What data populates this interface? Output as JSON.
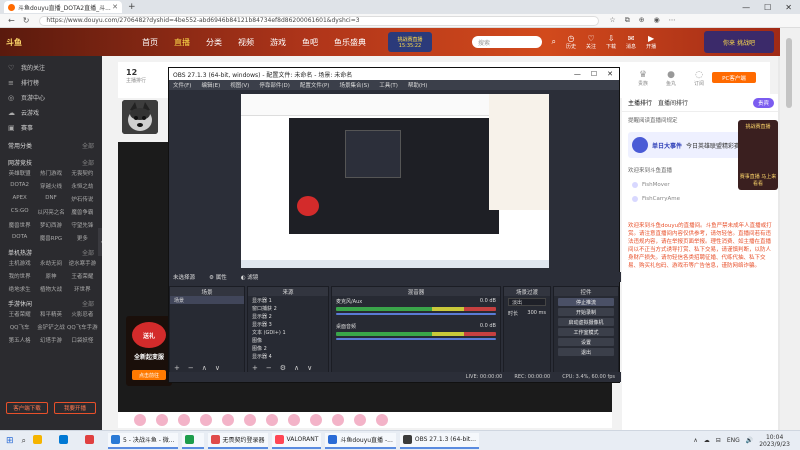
{
  "browser": {
    "tab_title": "斗鱼douyu直播_DOTA2直播_斗...",
    "url": "https://www.douyu.com/2706482?dyshid=4be552-abd6946b84121b84734ef8d86200061601&dyshci=3",
    "newtab": "+",
    "win_min": "—",
    "win_max": "☐",
    "win_close": "✕"
  },
  "site": {
    "nav": [
      "首页",
      "直播",
      "分类",
      "视频",
      "游戏",
      "鱼吧",
      "鱼乐盛典"
    ],
    "promo_top": "挑战赛直播",
    "promo_time": "15:35:22",
    "search_placeholder": "搜索",
    "header_icons": [
      "历史",
      "关注",
      "下载",
      "消息",
      "开播"
    ],
    "header_promo": "你来 挑战吧"
  },
  "sidebar": {
    "items": [
      {
        "icon": "♡",
        "label": "我的关注"
      },
      {
        "icon": "≡",
        "label": "排行榜"
      },
      {
        "icon": "◎",
        "label": "页游中心"
      },
      {
        "icon": "☁",
        "label": "云游戏"
      },
      {
        "icon": "▣",
        "label": "赛事"
      }
    ],
    "section_common": "常用分类",
    "section_online": "网游竞技",
    "section_more": "全部",
    "online_games": [
      "英雄联盟",
      "热门游戏",
      "无畏契约",
      "DOTA2",
      "穿越火线",
      "永恒之劫",
      "APEX",
      "DNF",
      "炉石传说",
      "CS:GO",
      "以闪亮之名",
      "魔兽争霸",
      "魔兽世界",
      "梦幻西游",
      "守望先锋",
      "DOTA",
      "魔兽RPG",
      "更多"
    ],
    "section_single": "单机热游",
    "single_games": [
      "主机游戏",
      "永劫无间",
      "逆水寒手游",
      "我的世界",
      "原神",
      "王者荣耀",
      "绝地求生",
      "植物大战",
      "环世界"
    ],
    "section_mobile": "手游休闲",
    "mobile_games": [
      "王者荣耀",
      "和平精英",
      "火影忍者",
      "QQ飞车",
      "金铲铲之战",
      "QQ飞车手游",
      "第五人格",
      "幻塔手游",
      "口袋妖怪"
    ],
    "btn_download": "客户端下载",
    "btn_live": "我要开播"
  },
  "room": {
    "rank_num": "12",
    "rank_label": "主播排行",
    "pc_client": "PC客户端",
    "icons": [
      "贵族",
      "鱼丸",
      "订阅"
    ]
  },
  "ad": {
    "badge": "送礼",
    "headline": "全新起变服",
    "cta": "点击前往"
  },
  "chat": {
    "tab_rank": "主播排行",
    "tab_gift": "直播间排行",
    "pill": "贵宾",
    "notice": "提醒阅读直播间规定",
    "event_title": "单日大事件",
    "event_text": "今日英雄联盟精彩赛事直播中",
    "note": "欢迎来到斗鱼直播",
    "users": [
      "FishMover",
      "FishCarryAme"
    ],
    "welcome": "欢迎来到斗鱼douyu的直播间。斗鱼严禁未成年人直播或打赏。请注意直播间内容仅供参考，请勿轻信。直播间若有违法违规内容，请在举报页面举报。理性消费、如主播在直播间以不正当方式诱导打赏、私下交易，请谨慎判断，以防人身财产损失。请勿轻信各类招聘征婚、代练代抽、私下交易、购买礼包码、游戏币等广告信息，谨防网络诈骗。",
    "side_ad_top": "挑战赛直播",
    "side_ad_bottom": "赛事直播 马上来看看"
  },
  "obs": {
    "title": "OBS 27.1.3 (64-bit, windows) - 配置文件: 未命名 - 场景: 未命名",
    "menu": [
      "文件(F)",
      "编辑(E)",
      "视图(V)",
      "停靠部件(D)",
      "配置文件(P)",
      "场景集合(S)",
      "工具(T)",
      "帮助(H)"
    ],
    "no_source": "未选择源",
    "props": "属性",
    "filters": "滤镜",
    "scenes_title": "场景",
    "scene_item": "场景",
    "sources_title": "来源",
    "sources": [
      "显示器 1",
      "窗口捕获 2",
      "显示器 2",
      "显示器 3",
      "文本 (GDI+) 1",
      "图像",
      "图像 2",
      "显示器 4",
      "显示器 5"
    ],
    "mixer_title": "混音器",
    "mixer_track1": "麦克风/Aux",
    "mixer_track1_db": "0.0 dB",
    "mixer_track2": "桌面音频",
    "mixer_track2_db": "0.0 dB",
    "transitions_title": "场景过渡",
    "transition_type": "淡出",
    "duration_label": "时长",
    "duration": "300 ms",
    "controls_title": "控件",
    "controls": [
      "停止推流",
      "开始录制",
      "启动虚拟摄像机",
      "工作室模式",
      "设置",
      "退出"
    ],
    "status_live": "LIVE: 00:00:00",
    "status_rec": "REC: 00:00:00",
    "status_cpu": "CPU: 3.4%, 60.00 fps"
  },
  "taskbar": {
    "start": "⊞",
    "search": "⌕",
    "apps": [
      {
        "label": "",
        "color": "#f5b400"
      },
      {
        "label": "",
        "color": "#0078d4"
      },
      {
        "label": "",
        "color": "#e04040"
      },
      {
        "label": "",
        "color": "#2a9d3a"
      },
      {
        "label": "",
        "color": "#4ab0ff"
      },
      {
        "label": "",
        "color": "#ff7a00"
      },
      {
        "label": "",
        "color": "#6a6a6a"
      },
      {
        "label": "",
        "color": "#2d2d2d"
      }
    ],
    "open_apps": [
      {
        "label": "5 - 决战斗鱼 - 微...",
        "color": "#2a7ad6"
      },
      {
        "label": "",
        "color": "#1d9d4c"
      },
      {
        "label": "无畏契约登录器",
        "color": "#e04b4b"
      },
      {
        "label": "VALORANT",
        "color": "#ff4655"
      },
      {
        "label": "斗鱼douyu直播 -...",
        "color": "#2a6bd6"
      },
      {
        "label": "OBS 27.1.3 (64-bit...",
        "color": "#3b3b3b"
      }
    ],
    "tray_lang": "ENG",
    "tray_icons": [
      "∧",
      "☁",
      "⊟",
      "🔊"
    ],
    "time": "10:04",
    "date": "2023/9/23"
  }
}
